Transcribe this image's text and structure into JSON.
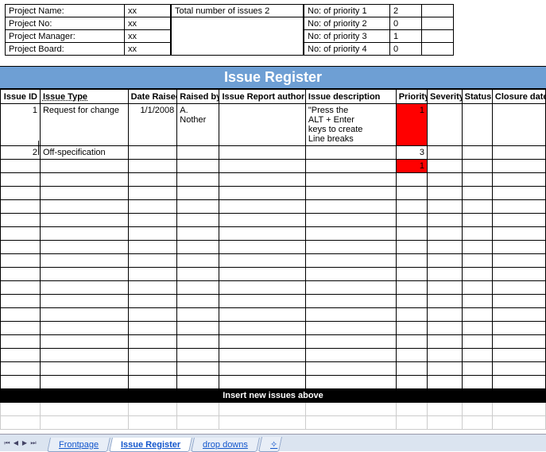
{
  "project": {
    "name_label": "Project Name:",
    "no_label": "Project No:",
    "mgr_label": "Project Manager:",
    "board_label": "Project Board:",
    "name": "xx",
    "no": "xx",
    "mgr": "xx",
    "board": "xx"
  },
  "summary": {
    "total_label": "Total number of issues 2",
    "p1_label": "No: of priority 1",
    "p2_label": "No: of priority 2",
    "p3_label": "No: of priority 3",
    "p4_label": "No: of priority 4",
    "p1": "2",
    "p2": "0",
    "p3": "1",
    "p4": "0"
  },
  "title": "Issue Register",
  "headers": {
    "id": "Issue ID",
    "type": "Issue Type",
    "date": "Date Raised",
    "by": "Raised by",
    "report": "Issue Report author",
    "desc": "Issue description",
    "pri": "Priority",
    "sev": "Severity",
    "stat": "Status",
    "close": "Closure date"
  },
  "rows": [
    {
      "id": "1",
      "type": "Request for change",
      "date": "1/1/2008",
      "by": "A. Nother",
      "report": "",
      "desc": "\"Press the\nALT + Enter\nkeys to create\nLine breaks",
      "pri": "1",
      "sev": "",
      "stat": "",
      "close": "",
      "tall": true,
      "pri_red": true
    },
    {
      "id": "2",
      "type": "Off-specification",
      "date": "",
      "by": "",
      "report": "",
      "desc": "",
      "pri": "3",
      "sev": "",
      "stat": "",
      "close": "",
      "tall": false,
      "pri_red": false
    },
    {
      "id": "",
      "type": "",
      "date": "",
      "by": "",
      "report": "",
      "desc": "",
      "pri": "1",
      "sev": "",
      "stat": "",
      "close": "",
      "tall": false,
      "pri_red": true
    }
  ],
  "empty_rows": 16,
  "insert_label": "Insert new issues above",
  "tabs": {
    "t1": "Frontpage",
    "t2": "Issue Register",
    "t3": "drop downs",
    "add": "⋮"
  }
}
